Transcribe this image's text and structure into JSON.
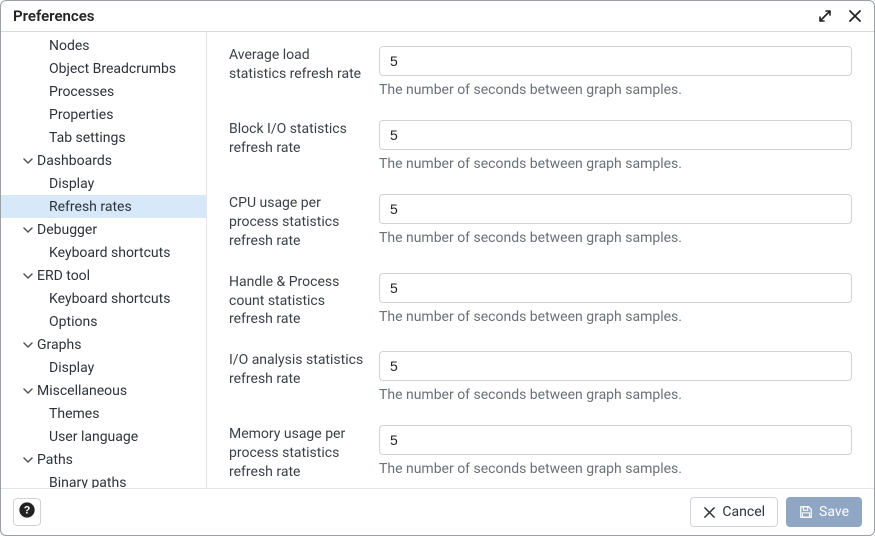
{
  "header": {
    "title": "Preferences"
  },
  "sidebar": {
    "items": [
      {
        "label": "Nodes",
        "level": 2,
        "expandable": false
      },
      {
        "label": "Object Breadcrumbs",
        "level": 2,
        "expandable": false
      },
      {
        "label": "Processes",
        "level": 2,
        "expandable": false
      },
      {
        "label": "Properties",
        "level": 2,
        "expandable": false
      },
      {
        "label": "Tab settings",
        "level": 2,
        "expandable": false
      },
      {
        "label": "Dashboards",
        "level": 1,
        "expandable": true,
        "expanded": true
      },
      {
        "label": "Display",
        "level": 2,
        "expandable": false
      },
      {
        "label": "Refresh rates",
        "level": 2,
        "expandable": false,
        "selected": true
      },
      {
        "label": "Debugger",
        "level": 1,
        "expandable": true,
        "expanded": true
      },
      {
        "label": "Keyboard shortcuts",
        "level": 2,
        "expandable": false
      },
      {
        "label": "ERD tool",
        "level": 1,
        "expandable": true,
        "expanded": true
      },
      {
        "label": "Keyboard shortcuts",
        "level": 2,
        "expandable": false
      },
      {
        "label": "Options",
        "level": 2,
        "expandable": false
      },
      {
        "label": "Graphs",
        "level": 1,
        "expandable": true,
        "expanded": true
      },
      {
        "label": "Display",
        "level": 2,
        "expandable": false
      },
      {
        "label": "Miscellaneous",
        "level": 1,
        "expandable": true,
        "expanded": true
      },
      {
        "label": "Themes",
        "level": 2,
        "expandable": false
      },
      {
        "label": "User language",
        "level": 2,
        "expandable": false
      },
      {
        "label": "Paths",
        "level": 1,
        "expandable": true,
        "expanded": true
      },
      {
        "label": "Binary paths",
        "level": 2,
        "expandable": false
      }
    ]
  },
  "content": {
    "fields": [
      {
        "label": "Average load statistics refresh rate",
        "value": "5",
        "help": "The number of seconds between graph samples."
      },
      {
        "label": "Block I/O statistics refresh rate",
        "value": "5",
        "help": "The number of seconds between graph samples."
      },
      {
        "label": "CPU usage per process statistics refresh rate",
        "value": "5",
        "help": "The number of seconds between graph samples."
      },
      {
        "label": "Handle & Process count statistics refresh rate",
        "value": "5",
        "help": "The number of seconds between graph samples."
      },
      {
        "label": "I/O analysis statistics refresh rate",
        "value": "5",
        "help": "The number of seconds between graph samples."
      },
      {
        "label": "Memory usage per process statistics refresh rate",
        "value": "5",
        "help": "The number of seconds between graph samples."
      }
    ]
  },
  "footer": {
    "cancel_label": "Cancel",
    "save_label": "Save"
  }
}
